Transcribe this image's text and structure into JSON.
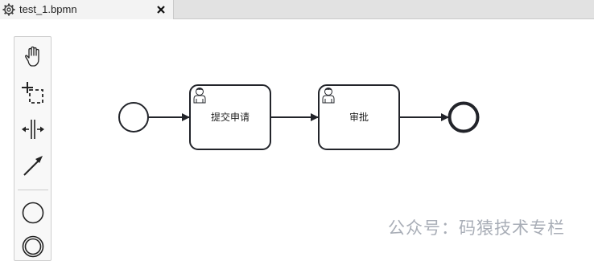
{
  "tab": {
    "title": "test_1.bpmn",
    "icon": "gear-icon",
    "close_icon": "close-icon"
  },
  "palette": {
    "tools": [
      {
        "name": "hand-tool",
        "icon": "hand-icon"
      },
      {
        "name": "lasso-tool",
        "icon": "lasso-icon"
      },
      {
        "name": "space-tool",
        "icon": "space-icon"
      },
      {
        "name": "connect-tool",
        "icon": "arrow-icon"
      },
      {
        "name": "create-start-event",
        "icon": "circle-icon"
      },
      {
        "name": "create-intermediate-event",
        "icon": "double-circle-icon"
      }
    ]
  },
  "diagram": {
    "start_event": {
      "type": "start-event"
    },
    "tasks": [
      {
        "label": "提交申请",
        "type": "user-task",
        "icon": "user-icon"
      },
      {
        "label": "审批",
        "type": "user-task",
        "icon": "user-icon"
      }
    ],
    "end_event": {
      "type": "end-event"
    }
  },
  "watermark": "公众号：码猿技术专栏",
  "colors": {
    "stroke": "#22242a",
    "tab_bg": "#f3f3f3",
    "tabbar_bg": "#e2e2e2",
    "watermark": "#a9aeb7"
  }
}
